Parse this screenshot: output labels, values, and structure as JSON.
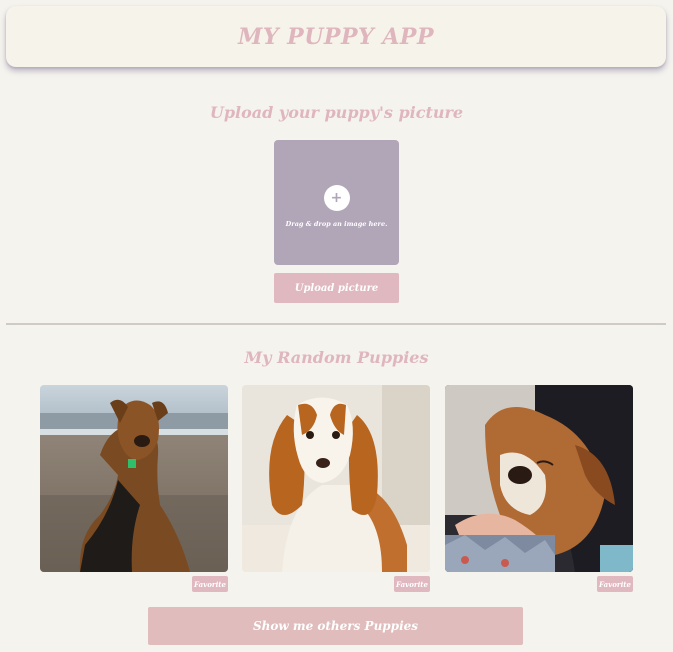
{
  "app": {
    "title": "MY PUPPY APP"
  },
  "upload": {
    "title": "Upload your puppy's picture",
    "plus_glyph": "+",
    "dropzone_text": "Drag & drop an image here.",
    "button_label": "Upload picture"
  },
  "random": {
    "title": "My Random Puppies",
    "cards": [
      {
        "image": "airedale-terrier-on-beach-photo",
        "favorite_label": "Favorite"
      },
      {
        "image": "cocker-spaniel-sitting-photo",
        "favorite_label": "Favorite"
      },
      {
        "image": "sleeping-puppy-in-lap-photo",
        "favorite_label": "Favorite"
      }
    ],
    "show_more_label": "Show me others Puppies"
  },
  "colors": {
    "background": "#f5f3ee",
    "accent_pink": "#e0b8c0",
    "title_pink": "#dfb6bd",
    "dropzone": "#b1a5b8"
  }
}
